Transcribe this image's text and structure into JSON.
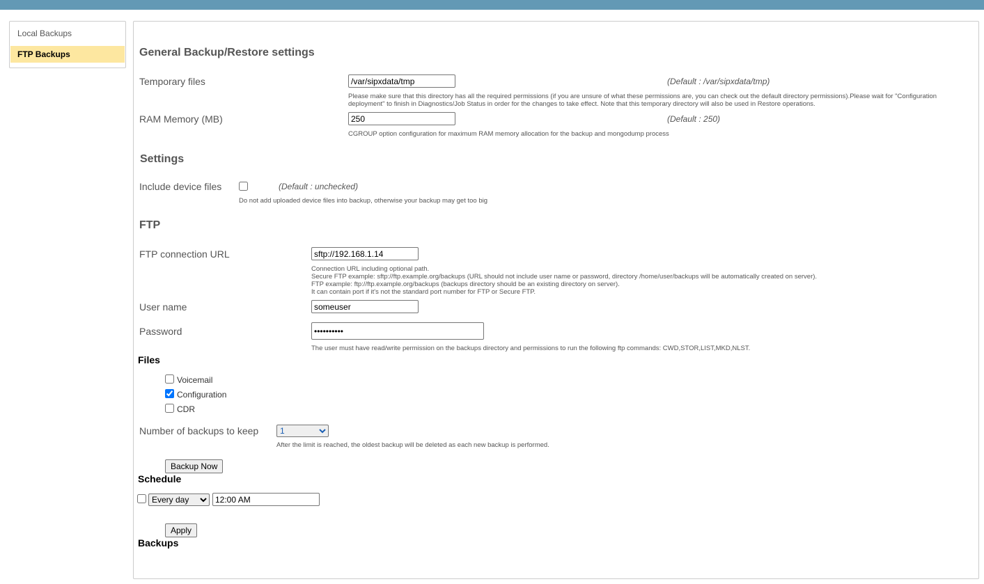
{
  "sidebar": {
    "items": [
      {
        "label": "Local Backups",
        "active": false
      },
      {
        "label": "FTP Backups",
        "active": true
      }
    ]
  },
  "general": {
    "title": "General Backup/Restore settings",
    "temp_label": "Temporary files",
    "temp_value": "/var/sipxdata/tmp",
    "temp_default": "(Default : /var/sipxdata/tmp)",
    "temp_help1": "Please make sure that this directory has all the required permissions (if you are unsure of what these permissions are, you can check out the default directory permissions).Please wait for \"Configuration",
    "temp_help2": "deployment\" to finish in Diagnostics/Job Status in order for the changes to take effect. Note that this temporary directory will also be used in Restore operations.",
    "ram_label": "RAM Memory (MB)",
    "ram_value": "250",
    "ram_default": "(Default : 250)",
    "ram_help": "CGROUP option configuration for maximum RAM memory allocation for the backup and mongodump process"
  },
  "settings": {
    "title": "Settings",
    "device_label": "Include device files",
    "device_checked": false,
    "device_default": "(Default : unchecked)",
    "device_help": "Do not add uploaded device files into backup, otherwise your backup may get too big"
  },
  "ftp": {
    "title": "FTP",
    "url_label": "FTP connection URL",
    "url_value": "sftp://192.168.1.14",
    "url_help": [
      "Connection URL including optional path.",
      "Secure FTP example: sftp://ftp.example.org/backups (URL should not include user name or password, directory /home/user/backups will be automatically created on server).",
      "FTP example: ftp://ftp.example.org/backups (backups directory should be an existing directory on server).",
      "It can contain port if it's not the standard port number for FTP or Secure FTP."
    ],
    "user_label": "User name",
    "user_value": "someuser",
    "password_label": "Password",
    "password_value": "••••••••••",
    "password_help": "The user must have read/write permission on the backups directory and permissions to run the following ftp commands: CWD,STOR,LIST,MKD,NLST."
  },
  "files": {
    "title": "Files",
    "items": [
      {
        "label": "Voicemail",
        "checked": false
      },
      {
        "label": "Configuration",
        "checked": true
      },
      {
        "label": "CDR",
        "checked": false
      }
    ]
  },
  "keep": {
    "label": "Number of backups to keep",
    "value": "1",
    "help": "After the limit is reached, the oldest backup will be deleted as each new backup is performed."
  },
  "backup_now": "Backup Now",
  "schedule": {
    "title": "Schedule",
    "enabled": false,
    "frequency": "Every day",
    "time": "12:00 AM"
  },
  "apply": "Apply",
  "backups": {
    "title": "Backups"
  }
}
